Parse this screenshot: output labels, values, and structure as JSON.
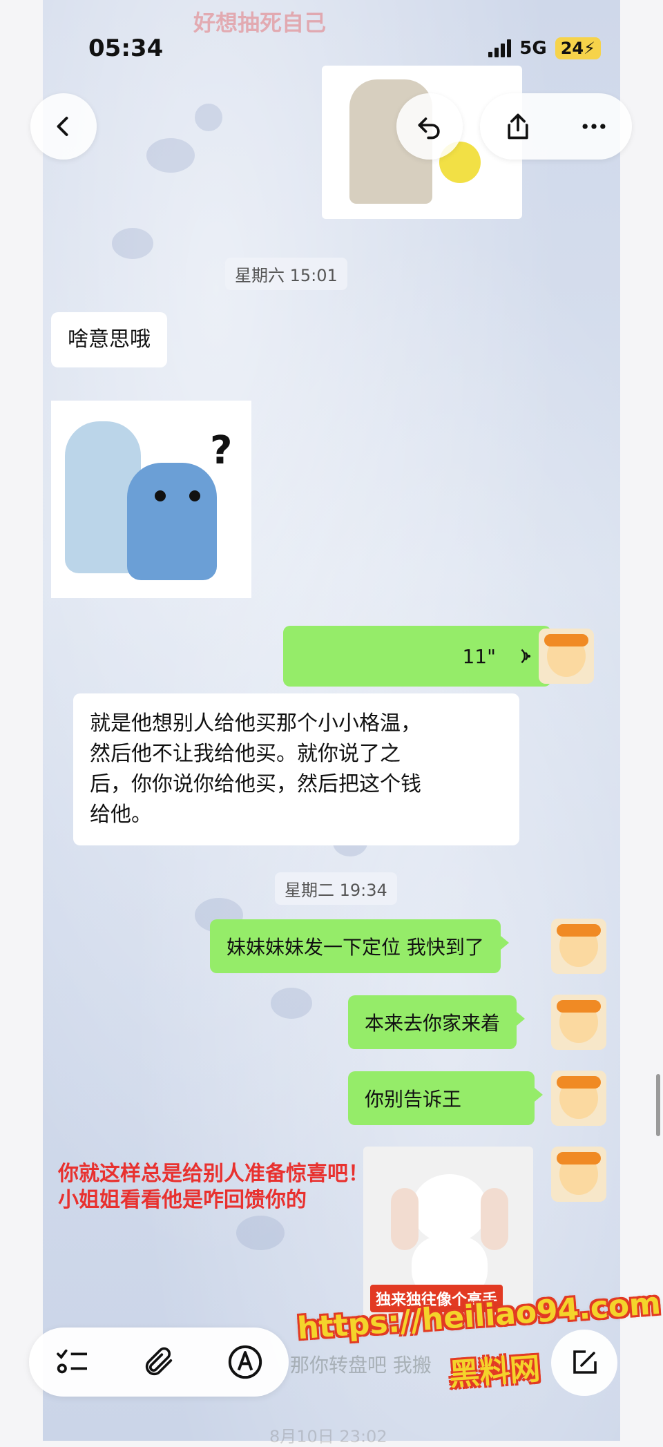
{
  "top_overlay_text": "好想抽死自己",
  "status_bar": {
    "time": "05:34",
    "network": "5G",
    "battery": "24"
  },
  "nav": {
    "back_icon": "chevron-left-icon",
    "reply_icon": "reply-arrow-icon",
    "share_icon": "share-icon",
    "more_icon": "ellipsis-icon"
  },
  "messages": [
    {
      "type": "timestamp",
      "text": "星期六 15:01"
    },
    {
      "type": "text_in",
      "text": "啥意思哦"
    },
    {
      "type": "sticker_in",
      "desc": "blue-cat-question-sticker"
    },
    {
      "type": "voice_out",
      "duration": "11\""
    },
    {
      "type": "transcript_in",
      "lines": [
        "就是他想别人给他买那个小小格温，",
        "然后他不让我给他买。就你说了之",
        "后，你你说你给他买，然后把这个钱",
        "给他。"
      ]
    },
    {
      "type": "timestamp",
      "text": "星期二 19:34"
    },
    {
      "type": "text_out",
      "text": "妹妹妹妹发一下定位 我快到了"
    },
    {
      "type": "text_out",
      "text": "本来去你家来着"
    },
    {
      "type": "text_out",
      "text": "你别告诉王"
    },
    {
      "type": "sticker_out",
      "caption": "独来独往像个高手"
    }
  ],
  "annotation": {
    "line1": "你就这样总是给别人准备惊喜吧！",
    "line2": "小姐姐看看他是咋回馈你的"
  },
  "bottom_bar": {
    "faded_message": "那你转盘吧 我搬",
    "faded_date": "8月10日 23:02",
    "watermark_url": "https://heiliao94.com",
    "watermark_cn": "黑料网"
  },
  "colors": {
    "bubble_out": "#95ec69",
    "bubble_in": "#ffffff",
    "annotation": "#e8312f"
  }
}
